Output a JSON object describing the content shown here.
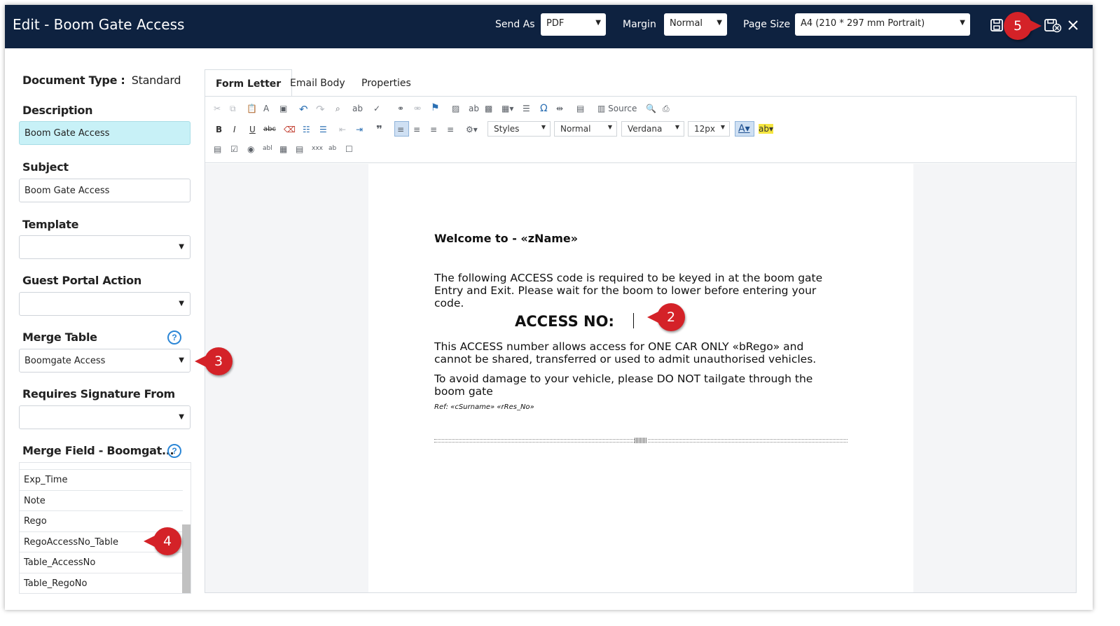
{
  "header": {
    "title": "Edit - Boom Gate Access",
    "send_as_label": "Send As",
    "send_as_value": "PDF",
    "margin_label": "Margin",
    "margin_value": "Normal",
    "page_size_label": "Page Size",
    "page_size_value": "A4 (210 * 297 mm Portrait)",
    "icons": [
      "save-icon",
      "save-and-close-icon",
      "close-icon"
    ]
  },
  "left": {
    "doc_type_label": "Document Type :",
    "doc_type_value": "Standard",
    "description_label": "Description",
    "description_value": "Boom Gate Access",
    "subject_label": "Subject",
    "subject_value": "Boom Gate Access",
    "template_label": "Template",
    "template_value": "",
    "guest_portal_label": "Guest Portal Action",
    "guest_portal_value": "",
    "merge_table_label": "Merge Table",
    "merge_table_value": "Boomgate Access",
    "requires_sig_label": "Requires Signature From",
    "requires_sig_value": "",
    "merge_field_label": "Merge Field - Boomgat...",
    "merge_fields": [
      "Exp_Time",
      "Note",
      "Rego",
      "RegoAccessNo_Table",
      "Table_AccessNo",
      "Table_RegoNo"
    ]
  },
  "tabs": [
    "Form Letter",
    "Email Body",
    "Properties"
  ],
  "toolbar": {
    "source_label": "Source",
    "styles": "Styles",
    "format": "Normal",
    "font": "Verdana",
    "size": "12px"
  },
  "document": {
    "welcome": "Welcome to - «zName»",
    "para1": "The following ACCESS code is required to be keyed in at the boom gate Entry and Exit. Please wait for the boom to lower before entering your code.",
    "access_no": "ACCESS NO:",
    "para2": "This ACCESS number allows access for ONE CAR ONLY «bRego» and cannot be shared, transferred or used to admit unauthorised vehicles.",
    "para3": "To avoid damage to your vehicle, please DO NOT tailgate through the boom gate",
    "ref": "Ref: «cSurname» «rRes_No»"
  },
  "callouts": [
    "2",
    "3",
    "4",
    "5"
  ],
  "colors": {
    "header_bg": "#0e2240",
    "callout": "#d42228",
    "highlight_field": "#c8f1f7",
    "help_icon": "#2b86d6"
  }
}
